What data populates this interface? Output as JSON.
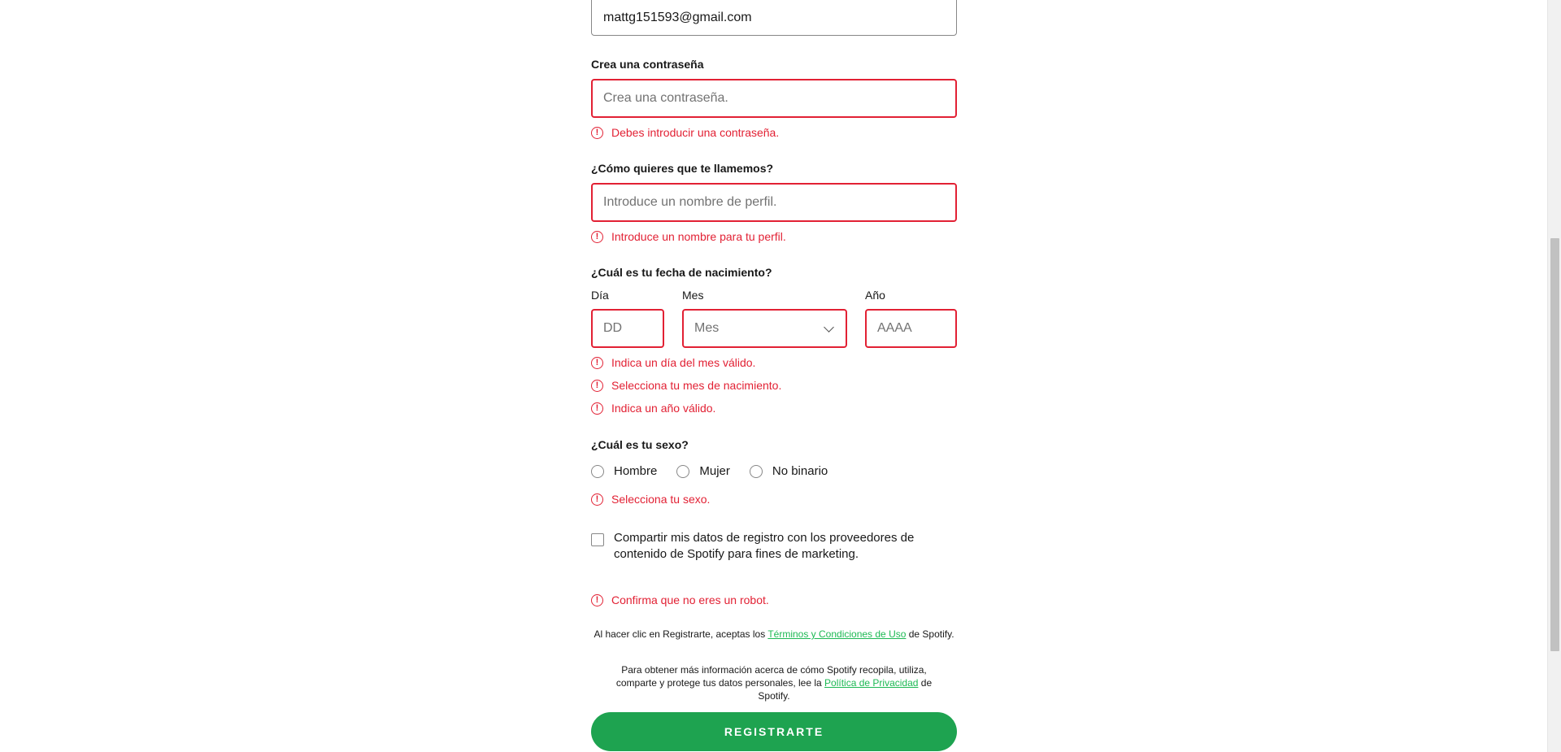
{
  "email": {
    "value": "mattg151593@gmail.com"
  },
  "password": {
    "label": "Crea una contraseña",
    "placeholder": "Crea una contraseña.",
    "error": "Debes introducir una contraseña."
  },
  "profile_name": {
    "label": "¿Cómo quieres que te llamemos?",
    "placeholder": "Introduce un nombre de perfil.",
    "error": "Introduce un nombre para tu perfil."
  },
  "birthdate": {
    "label": "¿Cuál es tu fecha de nacimiento?",
    "day_label": "Día",
    "day_placeholder": "DD",
    "month_label": "Mes",
    "month_value": "Mes",
    "year_label": "Año",
    "year_placeholder": "AAAA",
    "errors": [
      "Indica un día del mes válido.",
      "Selecciona tu mes de nacimiento.",
      "Indica un año válido."
    ]
  },
  "gender": {
    "label": "¿Cuál es tu sexo?",
    "options": [
      "Hombre",
      "Mujer",
      "No binario"
    ],
    "error": "Selecciona tu sexo."
  },
  "marketing_checkbox": {
    "label": "Compartir mis datos de registro con los proveedores de contenido de Spotify para fines de marketing."
  },
  "captcha_error": "Confirma que no eres un robot.",
  "legal": {
    "terms_prefix": "Al hacer clic en Registrarte, aceptas los ",
    "terms_link": "Términos y Condiciones de Uso",
    "terms_suffix": " de Spotify.",
    "privacy_prefix": "Para obtener más información acerca de cómo Spotify recopila, utiliza, comparte y protege tus datos personales, lee la ",
    "privacy_link": "Política de Privacidad",
    "privacy_suffix": " de Spotify."
  },
  "submit_label": "REGISTRARTE",
  "colors": {
    "error": "#e22134",
    "accent": "#1ea350",
    "link": "#1db954"
  },
  "icons": {
    "error": "error-circle-icon",
    "dropdown": "chevron-down-icon"
  }
}
